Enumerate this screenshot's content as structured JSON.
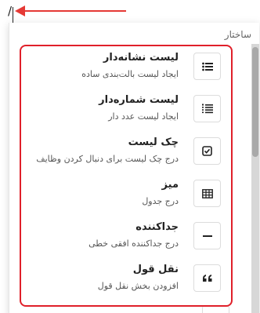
{
  "editor": {
    "typed_text": "/"
  },
  "menu": {
    "group_label": "ساختار",
    "items": [
      {
        "title": "لیست نشانه‌دار",
        "description": "ایجاد لیست بالت‌بندی ساده",
        "icon": "bulleted-list-icon"
      },
      {
        "title": "لیست شماره‌دار",
        "description": "ایجاد لیست عدد دار",
        "icon": "numbered-list-icon"
      },
      {
        "title": "چک لیست",
        "description": "درج چک لیست برای دنبال کردن وظایف",
        "icon": "checkbox-icon"
      },
      {
        "title": "میز",
        "description": "درج جدول",
        "icon": "table-icon"
      },
      {
        "title": "جداکننده",
        "description": "درج جداکننده افقی خطی",
        "icon": "divider-icon"
      },
      {
        "title": "نقل قول",
        "description": "افزودن بخش نقل قول",
        "icon": "quote-icon"
      }
    ]
  },
  "colors": {
    "annotation": "#e53935",
    "highlight_border": "#e0202a"
  }
}
